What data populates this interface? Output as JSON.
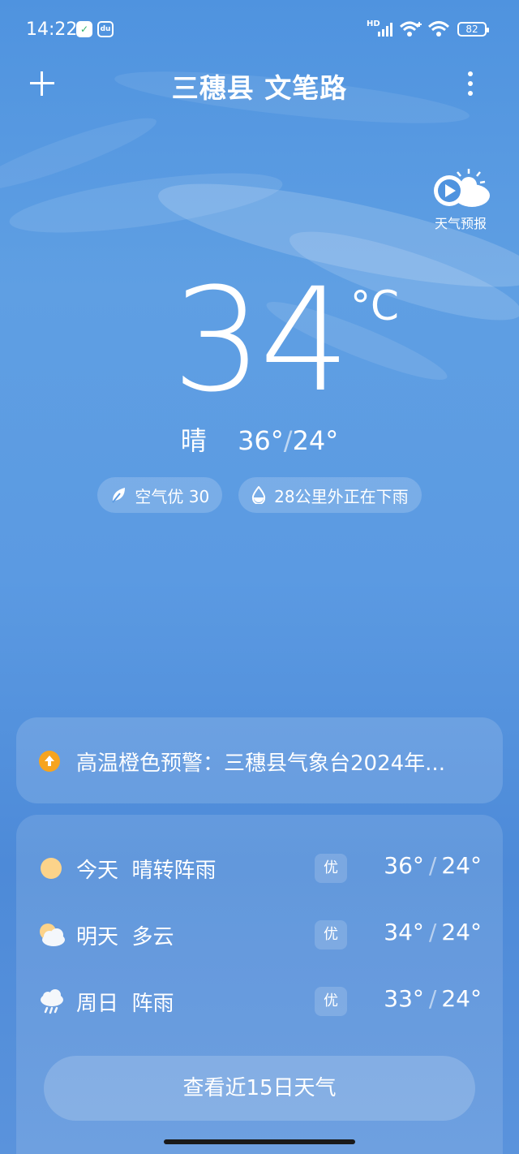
{
  "status_bar": {
    "time": "14:22",
    "network": "HD",
    "battery": "82"
  },
  "header": {
    "title": "三穗县 文笔路"
  },
  "forecast_video": {
    "label": "天气预报"
  },
  "current": {
    "temperature": "34",
    "unit": "°C",
    "condition": "晴",
    "high": "36°",
    "low": "24°",
    "range_separator": "/"
  },
  "pills": [
    {
      "icon": "leaf-icon",
      "text": "空气优 30"
    },
    {
      "icon": "raindrop-icon",
      "text": "28公里外正在下雨"
    }
  ],
  "alert": {
    "icon": "warning-up-arrow-icon",
    "color": "#f6a41f",
    "text": "高温橙色预警：三穗县气象台2024年..."
  },
  "daily": [
    {
      "day": "今天",
      "condition": "晴转阵雨",
      "icon": "sun-icon",
      "aqi": "优",
      "high": "36°",
      "low": "24°"
    },
    {
      "day": "明天",
      "condition": "多云",
      "icon": "partly-cloudy-icon",
      "aqi": "优",
      "high": "34°",
      "low": "24°"
    },
    {
      "day": "周日",
      "condition": "阵雨",
      "icon": "shower-icon",
      "aqi": "优",
      "high": "33°",
      "low": "24°"
    }
  ],
  "button_15_days": "查看近15日天气",
  "slash": "/"
}
